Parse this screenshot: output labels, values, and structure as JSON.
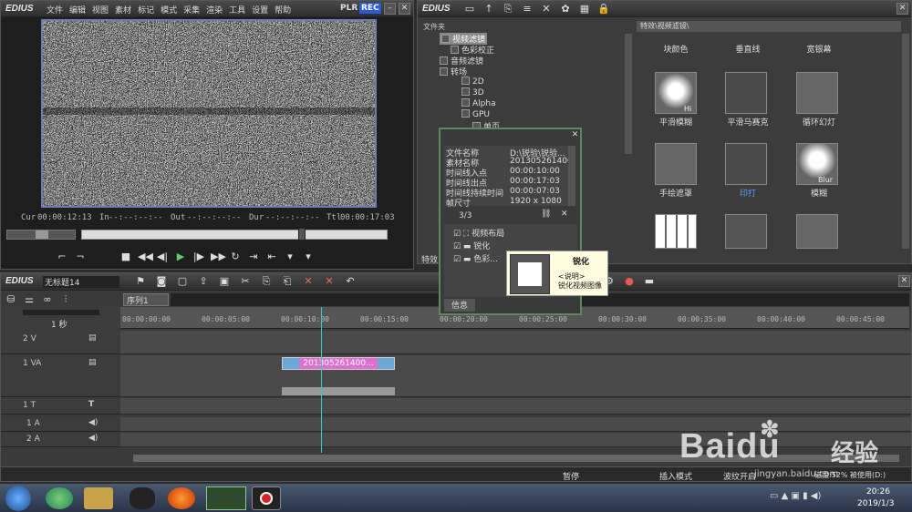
{
  "player": {
    "logo": "EDIUS",
    "menu": [
      "文件",
      "编辑",
      "视图",
      "素材",
      "标记",
      "模式",
      "采集",
      "渲染",
      "工具",
      "设置",
      "帮助"
    ],
    "plr": "PLR",
    "rec": "REC",
    "timecodes": {
      "cur_label": "Cur",
      "cur": "00:00:12:13",
      "in_label": "In",
      "in": "--:--:--:--",
      "out_label": "Out",
      "out": "--:--:--:--",
      "dur_label": "Dur",
      "dur": "--:--:--:--",
      "ttl_label": "Ttl",
      "ttl": "00:00:17:03"
    }
  },
  "library": {
    "logo": "EDIUS",
    "folder_header": "文件夹",
    "path_header": "特效\\视频滤镜\\",
    "tree": [
      {
        "label": "视频滤镜",
        "indent": 1,
        "selected": true
      },
      {
        "label": "色彩校正",
        "indent": 2
      },
      {
        "label": "音频滤镜",
        "indent": 1
      },
      {
        "label": "转场",
        "indent": 1
      },
      {
        "label": "2D",
        "indent": 2
      },
      {
        "label": "3D",
        "indent": 2
      },
      {
        "label": "Alpha",
        "indent": 2
      },
      {
        "label": "GPU",
        "indent": 2
      },
      {
        "label": "单页",
        "indent": 3
      }
    ],
    "effects": [
      {
        "label": "块颜色"
      },
      {
        "label": "垂直线"
      },
      {
        "label": "宽银幕"
      },
      {
        "label": "平滑模糊",
        "badge": "Hi"
      },
      {
        "label": "平滑马赛克"
      },
      {
        "label": "循环幻灯"
      },
      {
        "label": "手绘遮罩"
      },
      {
        "label": "印打",
        "highlight": true
      },
      {
        "label": "模糊",
        "badge": "Blur"
      },
      {
        "label": ""
      },
      {
        "label": ""
      },
      {
        "label": ""
      }
    ],
    "bottom_tab": "特效"
  },
  "info_panel": {
    "rows": [
      {
        "k": "文件名称",
        "v": "D:\\锐验\\锐验..."
      },
      {
        "k": "素材名称",
        "v": "201305261400..."
      },
      {
        "k": "时间线入点",
        "v": "00:00:10:00"
      },
      {
        "k": "时间线出点",
        "v": "00:00:17:03"
      },
      {
        "k": "时间线持续时间",
        "v": "00:00:07:03"
      },
      {
        "k": "帧尺寸",
        "v": "1920 x 1080"
      }
    ],
    "count": "3/3",
    "filters": [
      {
        "label": "视频布局"
      },
      {
        "label": "锐化"
      },
      {
        "label": "色彩..."
      }
    ],
    "tab": "信息"
  },
  "tooltip": {
    "title": "锐化",
    "desc_label": "<说明>",
    "desc": "锐化视频图像"
  },
  "timeline": {
    "logo": "EDIUS",
    "project": "无标题14",
    "sequence_tab": "序列1",
    "zoom": "1 秒",
    "ruler": [
      "00:00:00:00",
      "00:00:05:00",
      "00:00:10:00",
      "00:00:15:00",
      "00:00:20:00",
      "00:00:25:00",
      "00:00:30:00",
      "00:00:35:00",
      "00:00:40:00",
      "00:00:45:00"
    ],
    "tracks": [
      {
        "name": "2 V"
      },
      {
        "name": "1 VA"
      },
      {
        "name": "1 T"
      },
      {
        "name": "1 A"
      },
      {
        "name": "2 A"
      }
    ],
    "clip": "201305261400..."
  },
  "status": {
    "pause": "暂停",
    "insert": "插入模式",
    "ripple": "波纹开启",
    "disk": "磁盘:52% 被使用(D:)"
  },
  "watermark": {
    "brand": "Baidu",
    "cn": "经验",
    "url": "jingyan.baidu.com"
  },
  "taskbar": {
    "time": "20:26",
    "date": "2019/1/3"
  }
}
